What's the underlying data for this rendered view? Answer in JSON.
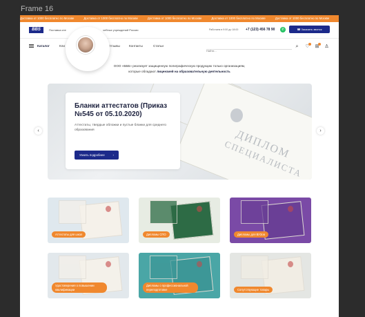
{
  "frame_label": "Frame 16",
  "promo": {
    "text": "Доставка от 1000 бесплатно по Москве",
    "repeat": 5
  },
  "header": {
    "logo": "BBS",
    "tagline_left": "Поставка спе",
    "tagline_right": "чебных учреждений России",
    "hours": "Работаем в 9:00 до 18:00",
    "phone": "+7 (123) 456 78 90",
    "callback_label": "Заказать звонок"
  },
  "nav": {
    "catalog": "Каталог",
    "items": [
      "Кли",
      "Отзывы",
      "Контакты",
      "Статьи"
    ],
    "search_placeholder": "Найти..."
  },
  "intro": {
    "line1": "ООО «БББ» реализует защищенную полиграфическую продукцию только организациям,",
    "line2_prefix": "которые обладают",
    "line2_bold": "лицензией на образовательную деятельность"
  },
  "hero": {
    "title": "Бланки аттестатов (Приказ №545 от 05.10.2020)",
    "subtitle": "Аттестаты, твердые обложки и пустые бланки для среднего образования",
    "button": "Узнать подробнее",
    "doc_text_1": "ДИПЛОМ",
    "doc_text_2": "СПЕЦИАЛИСТА"
  },
  "categories": [
    {
      "label": "Аттестаты для школ",
      "bg": "#dfe8ee",
      "doc": "#f5f1ea"
    },
    {
      "label": "Дипломы СПО",
      "bg": "#e7ece3",
      "doc": "#2d6b45"
    },
    {
      "label": "Дипломы для ВУЗов",
      "bg": "#7a4aa6",
      "doc": "#6a3f96"
    },
    {
      "label": "Удостоверения о повышении квалификации",
      "bg": "#e2e8ec",
      "doc": "#f4f1ea"
    },
    {
      "label": "Дипломы о профессиональной переподготовке",
      "bg": "#4aa6a6",
      "doc": "#3d9797"
    },
    {
      "label": "Сопутствующие товары",
      "bg": "#e4e6e3",
      "doc": "#f1ede4"
    }
  ],
  "colors": {
    "accent": "#f0882e",
    "brand": "#1c2a8a",
    "whatsapp": "#25c263"
  }
}
